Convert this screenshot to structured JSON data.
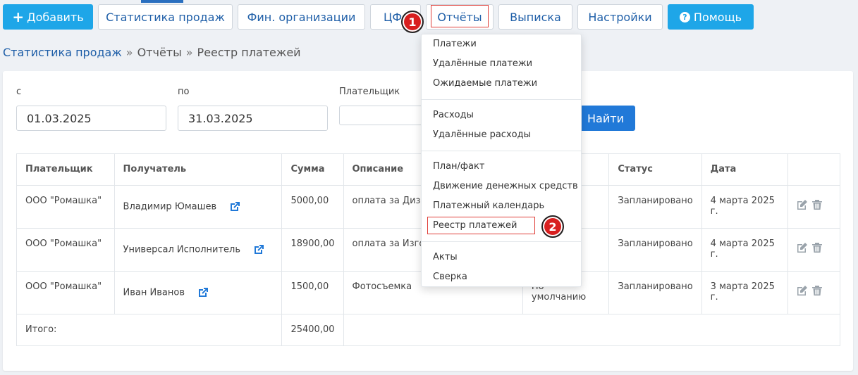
{
  "toolbar": {
    "add_label": "Добавить",
    "sales_stats_label": "Статистика продаж",
    "fin_orgs_label": "Фин. организации",
    "cfo_label": "ЦФ",
    "reports_label": "Отчёты",
    "statement_label": "Выписка",
    "settings_label": "Настройки",
    "help_label": "Помощь"
  },
  "markers": {
    "one": "1",
    "two": "2"
  },
  "breadcrumb": {
    "items": [
      "Статистика продаж",
      "Отчёты",
      "Реестр платежей"
    ],
    "separator": "»"
  },
  "filters": {
    "from_label": "с",
    "from_value": "01.03.2025",
    "to_label": "по",
    "to_value": "31.03.2025",
    "payer_label": "Плательщик",
    "payer_value": "",
    "find_label": "Найти"
  },
  "table": {
    "headers": [
      "Плательщик",
      "Получатель",
      "Сумма",
      "Описание",
      "",
      "Статус",
      "Дата",
      ""
    ],
    "rows": [
      {
        "payer": "ООО \"Ромашка\"",
        "recipient": "Владимир Юмашев",
        "amount": "5000,00",
        "description": "оплата за Дизай",
        "cfo": "",
        "status": "Запланировано",
        "date": "4 марта 2025 г."
      },
      {
        "payer": "ООО \"Ромашка\"",
        "recipient": "Универсал Исполнитель",
        "amount": "18900,00",
        "description": "оплата за Изгото",
        "cfo": "",
        "status": "Запланировано",
        "date": "4 марта 2025 г."
      },
      {
        "payer": "ООО \"Ромашка\"",
        "recipient": "Иван Иванов",
        "amount": "1500,00",
        "description": "Фотосъемка",
        "cfo": "По умолчанию",
        "status": "Запланировано",
        "date": "3 марта 2025 г."
      }
    ],
    "total_label": "Итого:",
    "total_amount": "25400,00"
  },
  "menu": {
    "items": [
      "Платежи",
      "Удалённые платежи",
      "Ожидаемые платежи",
      "Расходы",
      "Удалённые расходы",
      "План/факт",
      "Движение денежных средств",
      "Платежный календарь",
      "Реестр платежей",
      "Акты",
      "Сверка"
    ]
  },
  "icons": {
    "external": "external-link-icon",
    "edit": "edit-icon",
    "delete": "trash-icon",
    "help": "question-circle-icon",
    "plus": "plus-icon"
  },
  "colors": {
    "primary": "#1ea6e8",
    "link": "#1f5fa8",
    "accent_blue": "#2179d8",
    "highlight": "#e0403a",
    "marker": "#d81f1f"
  }
}
